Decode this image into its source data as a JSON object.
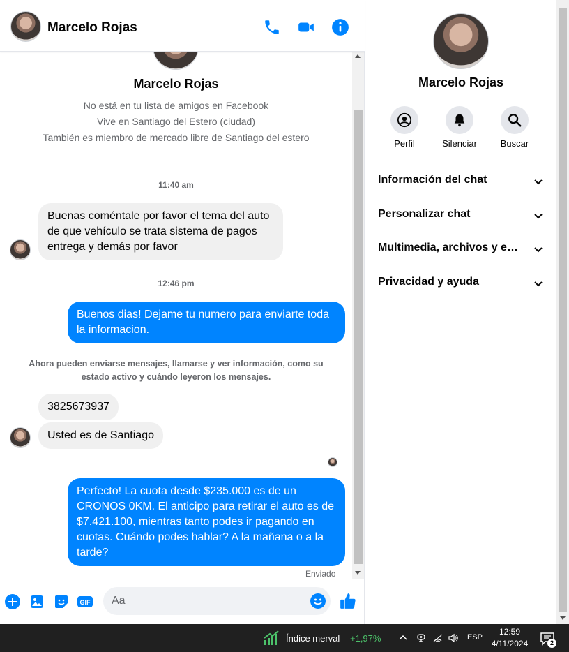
{
  "header": {
    "name": "Marcelo Rojas"
  },
  "profile": {
    "name": "Marcelo Rojas",
    "line1": "No está en tu lista de amigos en Facebook",
    "line2": "Vive en Santiago del Estero (ciudad)",
    "line3": "También es miembro de mercado libre de Santiago del estero"
  },
  "messages": {
    "ts1": "11:40 am",
    "m1": "Buenas coméntale por favor el tema del auto de que vehículo se trata sistema de pagos entrega y demás por favor",
    "ts2": "12:46 pm",
    "m2": "Buenos dias! Dejame tu numero para enviarte toda la informacion.",
    "notice": "Ahora pueden enviarse mensajes, llamarse y ver información, como su estado activo y cuándo leyeron los mensajes.",
    "m3": "3825673937",
    "m4": "Usted es de Santiago",
    "m5": "Perfecto! La cuota desde $235.000 es de un CRONOS 0KM. El anticipo para retirar el auto es de $7.421.100, mientras tanto podes ir pagando en cuotas. Cuándo podes hablar? A la mañana o a la tarde?",
    "status": "Enviado"
  },
  "composer": {
    "placeholder": "Aa"
  },
  "info_panel": {
    "name": "Marcelo Rojas",
    "actions": [
      {
        "label": "Perfil",
        "icon": "profile-icon"
      },
      {
        "label": "Silenciar",
        "icon": "bell-icon"
      },
      {
        "label": "Buscar",
        "icon": "search-icon"
      }
    ],
    "sections": [
      "Información del chat",
      "Personalizar chat",
      "Multimedia, archivos y enlaces",
      "Privacidad y ayuda"
    ]
  },
  "taskbar": {
    "market_label": "Índice merval",
    "market_change": "+1,97%",
    "lang": "ESP",
    "time": "12:59",
    "date": "4/11/2024",
    "notifications": "2"
  },
  "colors": {
    "messenger_blue": "#0084ff",
    "bubble_gray": "#f0f0f0",
    "taskbar": "#202020",
    "market_green": "#4cc26a"
  }
}
